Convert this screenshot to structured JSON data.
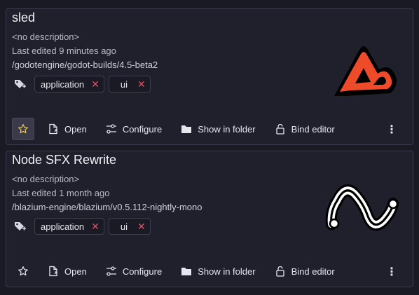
{
  "projects": [
    {
      "title": "sled",
      "description": "<no description>",
      "last_edited": "Last edited 9 minutes ago",
      "path": "/godotengine/godot-builds/4.5-beta2",
      "tags": [
        {
          "label": "application"
        },
        {
          "label": "ui"
        }
      ],
      "favorite": true,
      "logo": "sled-logo"
    },
    {
      "title": "Node SFX Rewrite",
      "description": "<no description>",
      "last_edited": "Last edited 1 month ago",
      "path": "/blazium-engine/blazium/v0.5.112-nightly-mono",
      "tags": [
        {
          "label": "application"
        },
        {
          "label": "ui"
        }
      ],
      "favorite": false,
      "logo": "wave-logo"
    }
  ],
  "actions": {
    "open": "Open",
    "configure": "Configure",
    "show_in_folder": "Show in folder",
    "bind_editor": "Bind editor",
    "more": "⋮"
  },
  "colors": {
    "background": "#1a1a25",
    "card": "#20202d",
    "tag_remove": "#e2506a",
    "favorite_star": "#f2c94c",
    "logo_orange": "#ee4b2b"
  }
}
